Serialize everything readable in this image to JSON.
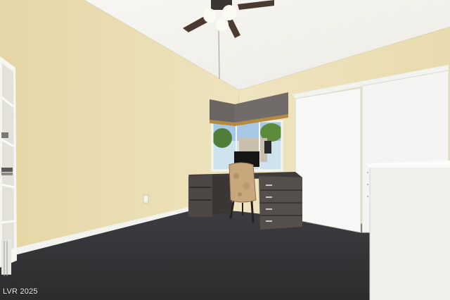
{
  "photo": {
    "watermark": "LVR 2025"
  },
  "colors": {
    "wall": "#e9dcb0",
    "ceiling": "#f4f3ef",
    "floor": "#343538",
    "closet_door": "#f7f7f5",
    "desk": "#4a4643",
    "valance": "#6d6866"
  },
  "icons": [
    "ceiling-fan-icon",
    "office-chair-icon",
    "window-icon",
    "monitor-icon"
  ]
}
